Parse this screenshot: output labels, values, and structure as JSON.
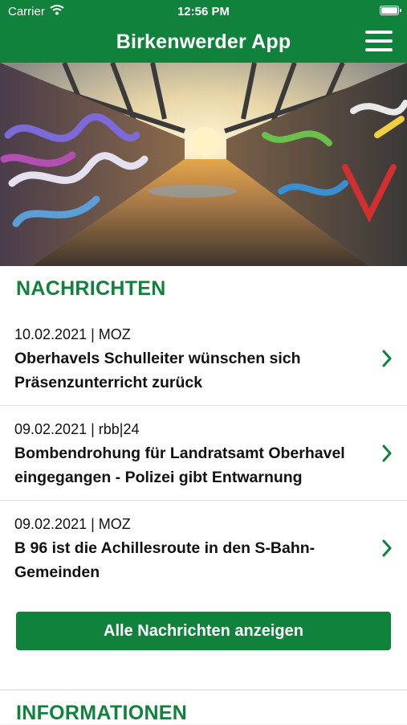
{
  "status_bar": {
    "carrier": "Carrier",
    "time": "12:56 PM"
  },
  "navbar": {
    "title": "Birkenwerder App",
    "menu_icon": "hamburger-menu-icon"
  },
  "hero": {
    "description_icon": "hero-bridge-photo"
  },
  "sections": {
    "news": {
      "title": "NACHRICHTEN"
    },
    "info": {
      "title": "INFORMATIONEN"
    }
  },
  "news": [
    {
      "meta": "10.02.2021 | MOZ",
      "headline_line1": "Oberhavels Schulleiter wünschen sich",
      "headline_line2": "Präsenzunterricht zurück"
    },
    {
      "meta": "09.02.2021 | rbb|24",
      "headline_line1": "Bombendrohung für Landratsamt Oberhavel",
      "headline_line2": "eingegangen - Polizei gibt Entwarnung"
    },
    {
      "meta": "09.02.2021 | MOZ",
      "headline_line1": "B 96 ist die Achillesroute in den S-Bahn-",
      "headline_line2": "Gemeinden"
    }
  ],
  "all_news_button": "Alle Nachrichten anzeigen",
  "colors": {
    "brand_green": "#11823b"
  }
}
